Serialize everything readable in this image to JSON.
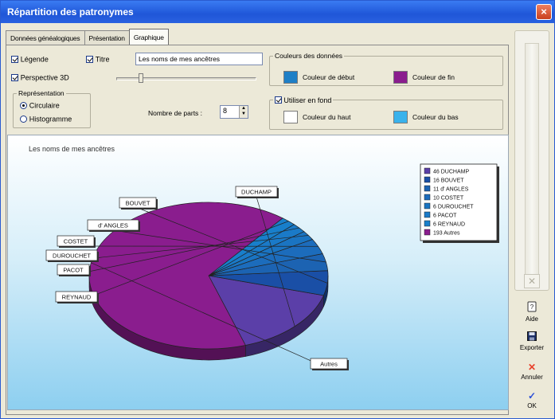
{
  "window": {
    "title": "Répartition des patronymes",
    "close": "×"
  },
  "tabs": [
    "Données généalogiques",
    "Présentation",
    "Graphique"
  ],
  "options": {
    "legend_label": "Légende",
    "title_label": "Titre",
    "title_value": "Les noms de mes ancêtres",
    "perspective_label": "Perspective 3D",
    "representation_group": "Représentation",
    "circular_label": "Circulaire",
    "histogram_label": "Histogramme",
    "parts_label": "Nombre de parts :",
    "parts_value": "8"
  },
  "colors": {
    "group_title": "Couleurs des données",
    "start_label": "Couleur de début",
    "end_label": "Couleur de fin",
    "background_label": "Utiliser en fond",
    "top_label": "Couleur du haut",
    "bottom_label": "Couleur du bas",
    "start_color": "#1e7fc6",
    "end_color": "#8a1d8e",
    "top_color": "#ffffff",
    "bottom_color": "#39b2ec"
  },
  "side": {
    "close_glyph": "✕",
    "help_label": "Aide",
    "export_label": "Exporter",
    "cancel_label": "Annuler",
    "ok_label": "OK"
  },
  "chart_data": {
    "type": "pie",
    "title": "Les noms de mes ancêtres",
    "slices": [
      {
        "name": "DUCHAMP",
        "legend": "46 DUCHAMP",
        "value": 46,
        "color": "#5b3fa8"
      },
      {
        "name": "BOUVET",
        "legend": "16 BOUVET",
        "value": 16,
        "color": "#1a4fa6"
      },
      {
        "name": "d' ANGLES",
        "legend": "11 d' ANGLES",
        "value": 11,
        "color": "#1c63b2"
      },
      {
        "name": "COSTET",
        "legend": "10 COSTET",
        "value": 10,
        "color": "#1c6cbc"
      },
      {
        "name": "DUROUCHET",
        "legend": "6 DUROUCHET",
        "value": 6,
        "color": "#1a74c2"
      },
      {
        "name": "PACOT",
        "legend": "6 PACOT",
        "value": 6,
        "color": "#1a7ac8"
      },
      {
        "name": "REYNAUD",
        "legend": "6 REYNAUD",
        "value": 6,
        "color": "#187fcb"
      },
      {
        "name": "Autres",
        "legend": "193 Autres",
        "value": 193,
        "color": "#8a1d8e"
      }
    ]
  }
}
